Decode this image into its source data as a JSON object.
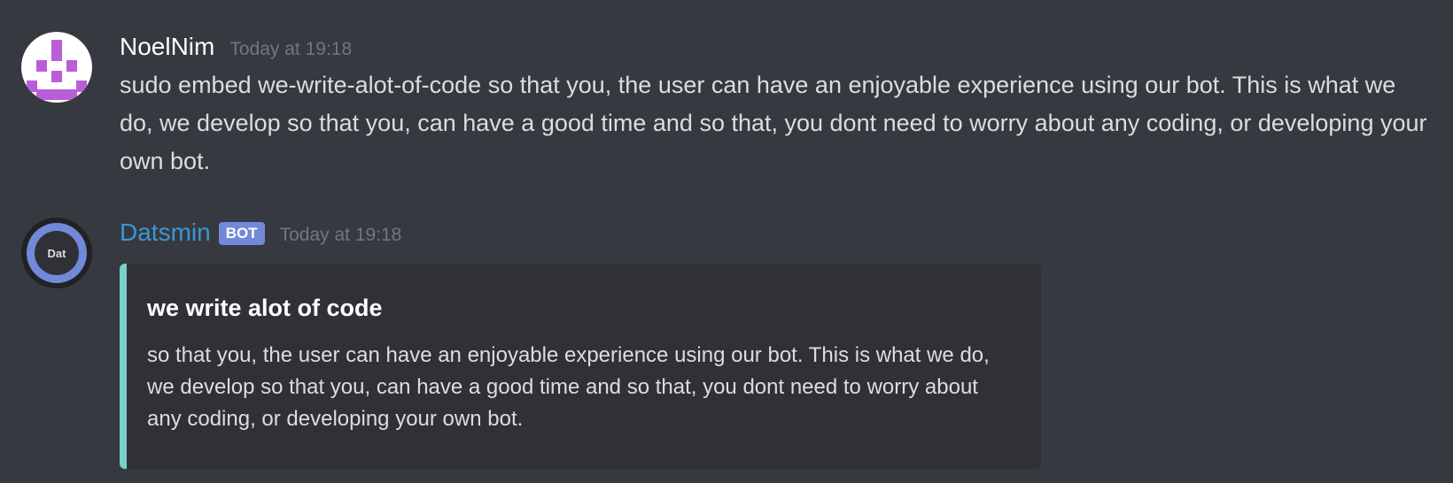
{
  "messages": [
    {
      "author": "NoelNim",
      "timestamp": "Today at 19:18",
      "content": "sudo embed we-write-alot-of-code so that you, the user can have an enjoyable experience using our bot. This is what we do, we develop so that you, can have a good time and so that, you dont need to worry about any coding, or developing your own bot.",
      "avatar_icon": "purple-pixel-glyph-icon",
      "avatar_color": "#b95ed6"
    },
    {
      "author": "Datsmin",
      "author_color": "#3a97d4",
      "bot_tag": "BOT",
      "timestamp": "Today at 19:18",
      "avatar_label": "Dat",
      "avatar_ring_color": "#7289da",
      "embed": {
        "title": "we write alot of code",
        "description": "so that you, the user can have an enjoyable experience using our bot. This is what we do, we develop so that you, can have a good time and so that, you dont need to worry about any coding, or developing your own bot.",
        "accent_color": "#76d1c9"
      }
    }
  ]
}
